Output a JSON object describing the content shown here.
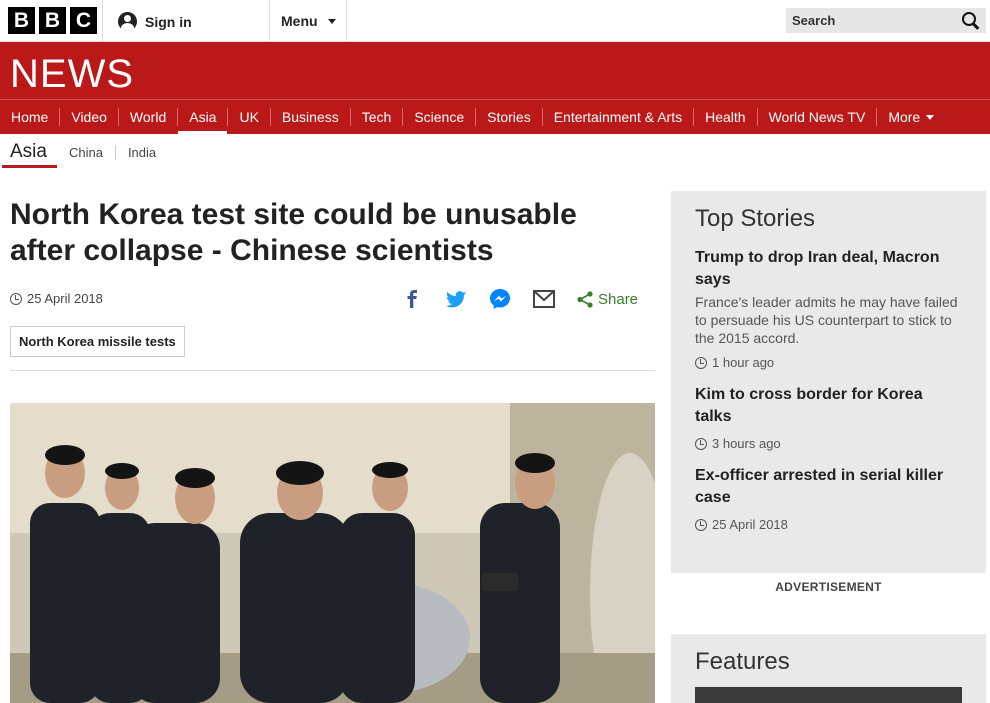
{
  "topbar": {
    "logo_letters": [
      "B",
      "B",
      "C"
    ],
    "signin_label": "Sign in",
    "menu_label": "Menu",
    "search_label": "Search"
  },
  "masthead": {
    "title": "NEWS",
    "brand_color": "#bb1919"
  },
  "nav": {
    "items": [
      "Home",
      "Video",
      "World",
      "Asia",
      "UK",
      "Business",
      "Tech",
      "Science",
      "Stories",
      "Entertainment & Arts",
      "Health",
      "World News TV"
    ],
    "active": "Asia",
    "more_label": "More"
  },
  "subnav": {
    "current": "Asia",
    "items": [
      "China",
      "India"
    ]
  },
  "article": {
    "headline": "North Korea test site could be unusable after collapse - Chinese scientists",
    "date": "25 April 2018",
    "share_label": "Share",
    "tag": "North Korea missile tests"
  },
  "sidebar": {
    "title": "Top Stories",
    "stories": [
      {
        "title": "Trump to drop Iran deal, Macron says",
        "summary": "France's leader admits he may have failed to persuade his US counterpart to stick to the 2015 accord.",
        "time": "1 hour ago"
      },
      {
        "title": "Kim to cross border for Korea talks",
        "summary": "",
        "time": "3 hours ago"
      },
      {
        "title": "Ex-officer arrested in serial killer case",
        "summary": "",
        "time": "25 April 2018"
      }
    ],
    "advertisement_label": "ADVERTISEMENT",
    "features_title": "Features"
  }
}
